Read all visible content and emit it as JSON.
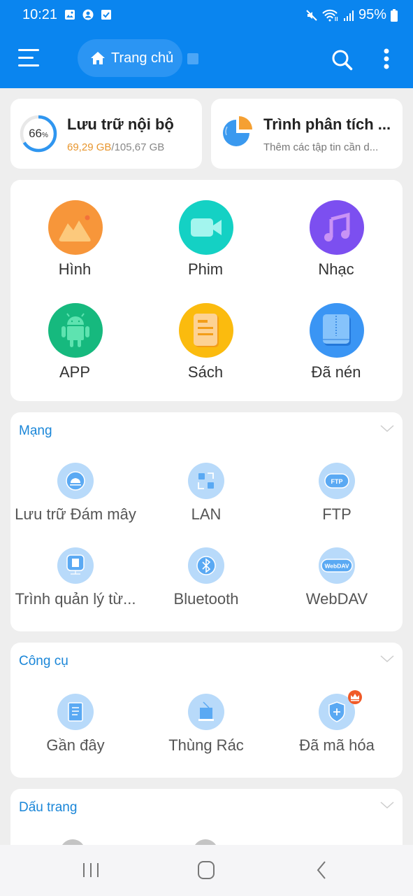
{
  "status_bar": {
    "time": "10:21",
    "battery": "95%",
    "icons_left": [
      "image-icon",
      "account-icon",
      "checkbox-icon"
    ],
    "icons_right": [
      "mute-icon",
      "wifi-icon",
      "signal-icon",
      "battery-icon"
    ]
  },
  "app_bar": {
    "breadcrumb_home": "Trang chủ",
    "colors": {
      "primary": "#0a85ef"
    }
  },
  "storage": {
    "title": "Lưu trữ nội bộ",
    "percent": "66",
    "percent_sign": "%",
    "used_fraction": 0.66,
    "used": "69,29 GB",
    "separator": "/",
    "total": "105,67 GB"
  },
  "analyzer": {
    "title": "Trình phân tích ...",
    "subtitle": "Thêm các tập tin cần d..."
  },
  "categories": [
    {
      "label": "Hình",
      "icon": "image-icon",
      "color": "#f7963a"
    },
    {
      "label": "Phim",
      "icon": "video-icon",
      "color": "#14d1c4"
    },
    {
      "label": "Nhạc",
      "icon": "music-icon",
      "color": "#7c4ff0"
    },
    {
      "label": "APP",
      "icon": "android-icon",
      "color": "#16b97e"
    },
    {
      "label": "Sách",
      "icon": "book-icon",
      "color": "#fbbb0e"
    },
    {
      "label": "Đã nén",
      "icon": "archive-icon",
      "color": "#3a95f4"
    }
  ],
  "sections": {
    "network": {
      "title": "Mạng",
      "items": [
        {
          "label": "Lưu trữ Đám mây",
          "icon": "cloud-icon"
        },
        {
          "label": "LAN",
          "icon": "lan-icon"
        },
        {
          "label": "FTP",
          "icon": "ftp-icon"
        },
        {
          "label": "Trình quản lý từ...",
          "icon": "remote-manager-icon"
        },
        {
          "label": "Bluetooth",
          "icon": "bluetooth-icon"
        },
        {
          "label": "WebDAV",
          "icon": "webdav-icon"
        }
      ]
    },
    "tools": {
      "title": "Công cụ",
      "items": [
        {
          "label": "Gần đây",
          "icon": "recent-icon"
        },
        {
          "label": "Thùng Rác",
          "icon": "trash-icon"
        },
        {
          "label": "Đã mã hóa",
          "icon": "encrypted-icon",
          "badge": "premium-crown-icon"
        }
      ]
    },
    "bookmarks": {
      "title": "Dấu trang"
    }
  },
  "nav_bar": {
    "buttons": [
      "recents-button",
      "home-button",
      "back-button"
    ]
  }
}
